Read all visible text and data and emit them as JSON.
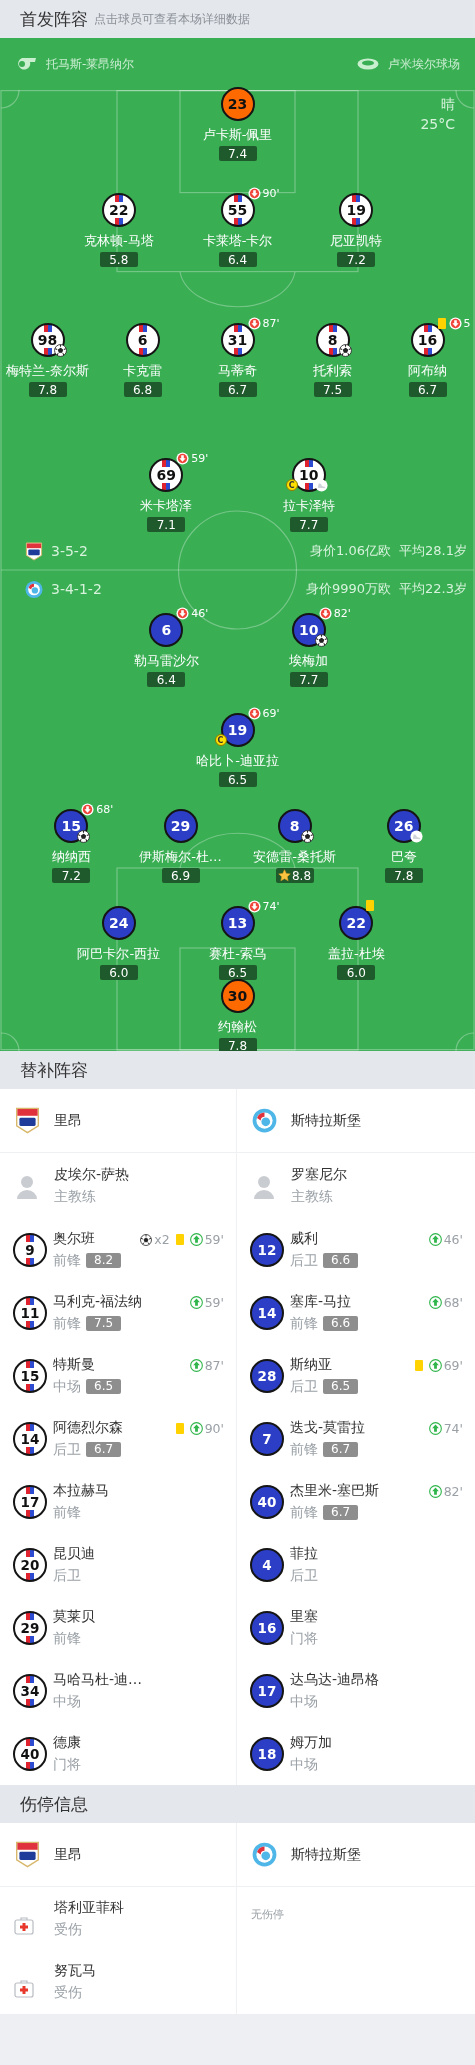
{
  "lineup": {
    "title": "首发阵容",
    "hint": "点击球员可查看本场详细数据",
    "referee": "托马斯-莱昂纳尔",
    "stadium": "卢米埃尔球场",
    "weather": "晴",
    "temperature": "25°C",
    "teams": [
      {
        "formation": "3-5-2",
        "value": "身价1.06亿欧",
        "avg_age": "平均28.1岁",
        "lines": [
          [
            {
              "number": "23",
              "name": "卢卡斯-佩里",
              "rating": "7.4",
              "kind": "goalkeeper"
            }
          ],
          [
            {
              "number": "22",
              "name": "克林顿-马塔",
              "rating": "5.8",
              "kind": "outfield"
            },
            {
              "number": "55",
              "name": "卡莱塔-卡尔",
              "rating": "6.4",
              "kind": "outfield",
              "events": [
                {
                  "kind": "sub_out",
                  "minute": "90'"
                }
              ]
            },
            {
              "number": "19",
              "name": "尼亚凯特",
              "rating": "7.2",
              "kind": "outfield"
            }
          ],
          [
            {
              "number": "98",
              "name": "梅特兰-奈尔斯",
              "rating": "7.8",
              "kind": "outfield",
              "events": [
                {
                  "kind": "goal"
                }
              ]
            },
            {
              "number": "6",
              "name": "卡克雷",
              "rating": "6.8",
              "kind": "outfield"
            },
            {
              "number": "31",
              "name": "马蒂奇",
              "rating": "6.7",
              "kind": "outfield",
              "events": [
                {
                  "kind": "sub_out",
                  "minute": "87'"
                }
              ]
            },
            {
              "number": "8",
              "name": "托利索",
              "rating": "7.5",
              "kind": "outfield",
              "events": [
                {
                  "kind": "goal"
                }
              ]
            },
            {
              "number": "16",
              "name": "阿布纳",
              "rating": "6.7",
              "kind": "outfield",
              "events": [
                {
                  "kind": "yellow_card"
                },
                {
                  "kind": "sub_out",
                  "minute": "5"
                }
              ]
            }
          ],
          [
            {
              "number": "69",
              "name": "米卡塔泽",
              "rating": "7.1",
              "kind": "outfield",
              "events": [
                {
                  "kind": "sub_out",
                  "minute": "59'"
                }
              ]
            },
            {
              "number": "10",
              "name": "拉卡泽特",
              "rating": "7.7",
              "kind": "outfield",
              "events": [
                {
                  "kind": "captain",
                  "label": "C"
                },
                {
                  "kind": "assist"
                }
              ]
            }
          ]
        ]
      },
      {
        "formation": "3-4-1-2",
        "value": "身价9990万欧",
        "avg_age": "平均22.3岁",
        "lines": [
          [
            {
              "number": "6",
              "name": "勒马雷沙尔",
              "rating": "6.4",
              "kind": "outfield",
              "events": [
                {
                  "kind": "sub_out",
                  "minute": "46'"
                }
              ]
            },
            {
              "number": "10",
              "name": "埃梅加",
              "rating": "7.7",
              "kind": "outfield",
              "events": [
                {
                  "kind": "sub_out",
                  "minute": "82'"
                },
                {
                  "kind": "goal"
                }
              ]
            }
          ],
          [
            {
              "number": "19",
              "name": "哈比卜-迪亚拉",
              "rating": "6.5",
              "kind": "outfield",
              "events": [
                {
                  "kind": "sub_out",
                  "minute": "69'"
                },
                {
                  "kind": "captain",
                  "label": "C"
                }
              ]
            }
          ],
          [
            {
              "number": "15",
              "name": "纳纳西",
              "rating": "7.2",
              "kind": "outfield",
              "events": [
                {
                  "kind": "sub_out",
                  "minute": "68'"
                },
                {
                  "kind": "goal"
                }
              ]
            },
            {
              "number": "29",
              "name": "伊斯梅尔-杜…",
              "rating": "6.9",
              "kind": "outfield"
            },
            {
              "number": "8",
              "name": "安德雷-桑托斯",
              "rating": "8.8",
              "kind": "outfield",
              "events": [
                {
                  "kind": "goal"
                },
                {
                  "kind": "best_player"
                }
              ]
            },
            {
              "number": "26",
              "name": "巴夸",
              "rating": "7.8",
              "kind": "outfield",
              "events": [
                {
                  "kind": "assist"
                }
              ]
            }
          ],
          [
            {
              "number": "24",
              "name": "阿巴卡尔-西拉",
              "rating": "6.0",
              "kind": "outfield"
            },
            {
              "number": "13",
              "name": "赛杜-索乌",
              "rating": "6.5",
              "kind": "outfield",
              "events": [
                {
                  "kind": "sub_out",
                  "minute": "74'"
                }
              ]
            },
            {
              "number": "22",
              "name": "盖拉-杜埃",
              "rating": "6.0",
              "kind": "outfield",
              "events": [
                {
                  "kind": "yellow_card"
                }
              ]
            }
          ],
          [
            {
              "number": "30",
              "name": "约翰松",
              "rating": "7.8",
              "kind": "goalkeeper"
            }
          ]
        ]
      }
    ]
  },
  "substitutes": {
    "title": "替补阵容",
    "teams": [
      {
        "name": "里昂",
        "coach": {
          "name": "皮埃尔-萨热",
          "role": "主教练"
        },
        "players": [
          {
            "number": "9",
            "name": "奥尔班",
            "position": "前锋",
            "rating": "8.2",
            "events": [
              {
                "kind": "goal",
                "count": "x2"
              },
              {
                "kind": "yellow_card"
              },
              {
                "kind": "sub_in",
                "minute": "59'"
              }
            ]
          },
          {
            "number": "11",
            "name": "马利克-福法纳",
            "position": "前锋",
            "rating": "7.5",
            "events": [
              {
                "kind": "sub_in",
                "minute": "59'"
              }
            ]
          },
          {
            "number": "15",
            "name": "特斯曼",
            "position": "中场",
            "rating": "6.5",
            "events": [
              {
                "kind": "sub_in",
                "minute": "87'"
              }
            ]
          },
          {
            "number": "14",
            "name": "阿德烈尔森",
            "position": "后卫",
            "rating": "6.7",
            "events": [
              {
                "kind": "yellow_card"
              },
              {
                "kind": "sub_in",
                "minute": "90'"
              }
            ]
          },
          {
            "number": "17",
            "name": "本拉赫马",
            "position": "前锋"
          },
          {
            "number": "20",
            "name": "昆贝迪",
            "position": "后卫"
          },
          {
            "number": "29",
            "name": "莫莱贝",
            "position": "前锋"
          },
          {
            "number": "34",
            "name": "马哈马杜-迪…",
            "position": "中场"
          },
          {
            "number": "40",
            "name": "德康",
            "position": "门将"
          }
        ]
      },
      {
        "name": "斯特拉斯堡",
        "coach": {
          "name": "罗塞尼尔",
          "role": "主教练"
        },
        "players": [
          {
            "number": "12",
            "name": "威利",
            "position": "后卫",
            "rating": "6.6",
            "events": [
              {
                "kind": "sub_in",
                "minute": "46'"
              }
            ]
          },
          {
            "number": "14",
            "name": "塞库-马拉",
            "position": "前锋",
            "rating": "6.6",
            "events": [
              {
                "kind": "sub_in",
                "minute": "68'"
              }
            ]
          },
          {
            "number": "28",
            "name": "斯纳亚",
            "position": "后卫",
            "rating": "6.5",
            "events": [
              {
                "kind": "yellow_card"
              },
              {
                "kind": "sub_in",
                "minute": "69'"
              }
            ]
          },
          {
            "number": "7",
            "name": "迭戈-莫雷拉",
            "position": "前锋",
            "rating": "6.7",
            "events": [
              {
                "kind": "sub_in",
                "minute": "74'"
              }
            ]
          },
          {
            "number": "40",
            "name": "杰里米-塞巴斯",
            "position": "前锋",
            "rating": "6.7",
            "events": [
              {
                "kind": "sub_in",
                "minute": "82'"
              }
            ]
          },
          {
            "number": "4",
            "name": "菲拉",
            "position": "后卫"
          },
          {
            "number": "16",
            "name": "里塞",
            "position": "门将"
          },
          {
            "number": "17",
            "name": "达乌达-迪昂格",
            "position": "中场"
          },
          {
            "number": "18",
            "name": "姆万加",
            "position": "中场"
          }
        ]
      }
    ]
  },
  "injuries": {
    "title": "伤停信息",
    "teams": [
      {
        "name": "里昂",
        "players": [
          {
            "name": "塔利亚菲科",
            "status": "受伤"
          },
          {
            "name": "努瓦马",
            "status": "受伤"
          }
        ]
      },
      {
        "name": "斯特拉斯堡",
        "note": "无伤停"
      }
    ]
  }
}
